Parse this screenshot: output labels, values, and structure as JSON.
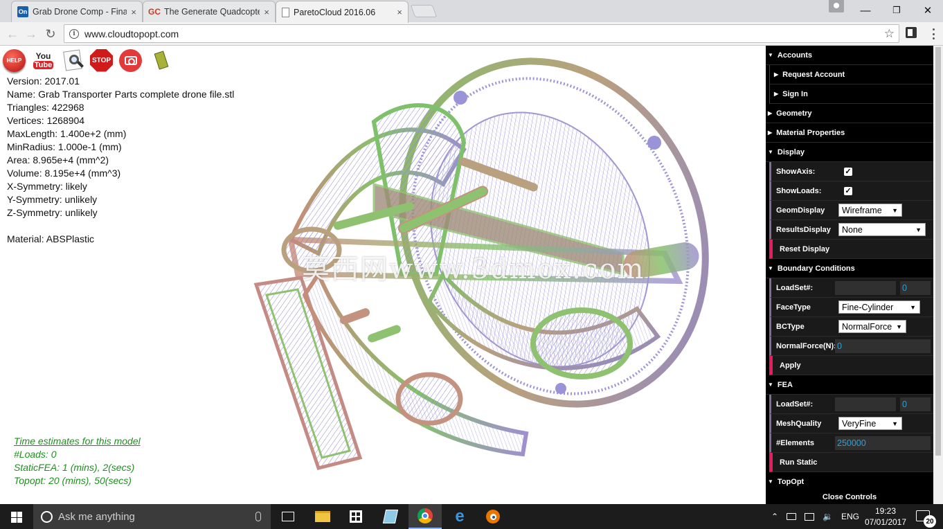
{
  "browser": {
    "tabs": [
      {
        "label": "Grab Drone Comp - Fina",
        "favicon": "On",
        "favicon_color": "#1b5fa8"
      },
      {
        "label": "The Generate Quadcopte",
        "favicon": "GC",
        "favicon_color": "#d0391e"
      },
      {
        "label": "ParetoCloud 2016.06",
        "favicon": "",
        "favicon_color": "#ffffff"
      }
    ],
    "close_glyph": "×",
    "url": "www.cloudtopopt.com",
    "window_controls": {
      "minimize": "—",
      "maximize": "❐",
      "close": "✕"
    }
  },
  "toolbar_icons": [
    "help-icon",
    "youtube-icon",
    "search-document-icon",
    "stop-icon",
    "camera-icon",
    "chip-icon"
  ],
  "toolbar_labels": {
    "help": "HELP",
    "youtube_you": "You",
    "youtube_tube": "Tube",
    "stop": "STOP"
  },
  "model_info": {
    "version": "Version: 2017.01",
    "name": "Name: Grab Transporter Parts complete drone file.stl",
    "triangles": "Triangles: 422968",
    "vertices": "Vertices: 1268904",
    "maxlength": "MaxLength: 1.400e+2 (mm)",
    "minradius": "MinRadius: 1.000e-1 (mm)",
    "area": "Area: 8.965e+4 (mm^2)",
    "volume": "Volume: 8.195e+4 (mm^3)",
    "xsym": "X-Symmetry: likely",
    "ysym": "Y-Symmetry: unlikely",
    "zsym": "Z-Symmetry: unlikely",
    "material": "Material: ABSPlastic"
  },
  "estimates": {
    "link": "Time estimates for this model",
    "loads": "#Loads: 0",
    "static_fea": "StaticFEA: 1 (mins), 2(secs)",
    "topopt": "Topopt: 20 (mins), 50(secs)"
  },
  "watermark": "莫西网www.3dmox.com",
  "controls": {
    "accounts": "Accounts",
    "request_account": "Request Account",
    "sign_in": "Sign In",
    "geometry": "Geometry",
    "material_properties": "Material Properties",
    "display": "Display",
    "show_axis": {
      "label": "ShowAxis:",
      "checked": true
    },
    "show_loads": {
      "label": "ShowLoads:",
      "checked": true
    },
    "geom_display": {
      "label": "GeomDisplay",
      "value": "Wireframe"
    },
    "results_display": {
      "label": "ResultsDisplay",
      "value": "None"
    },
    "reset_display": "Reset Display",
    "boundary_conditions": "Boundary Conditions",
    "bc_loadset": {
      "label": "LoadSet#:",
      "value": "0"
    },
    "face_type": {
      "label": "FaceType",
      "value": "Fine-Cylinder"
    },
    "bc_type": {
      "label": "BCType",
      "value": "NormalForce"
    },
    "normal_force": {
      "label": "NormalForce(N):",
      "value": "0"
    },
    "apply": "Apply",
    "fea": "FEA",
    "fea_loadset": {
      "label": "LoadSet#:",
      "value": "0"
    },
    "mesh_quality": {
      "label": "MeshQuality",
      "value": "VeryFine"
    },
    "elements": {
      "label": "#Elements",
      "value": "250000"
    },
    "run_static": "Run Static",
    "topopt": "TopOpt",
    "close_controls": "Close Controls",
    "accent_color": "#e61d5f",
    "number_color": "#2fa1d6"
  },
  "taskbar": {
    "search_placeholder": "Ask me anything",
    "apps": [
      "task-view-icon",
      "file-explorer-icon",
      "store-icon",
      "notepad-icon",
      "chrome-icon",
      "edge-icon",
      "blender-icon"
    ],
    "language": "ENG",
    "time": "19:23",
    "date": "07/01/2017",
    "notifications": "20"
  }
}
